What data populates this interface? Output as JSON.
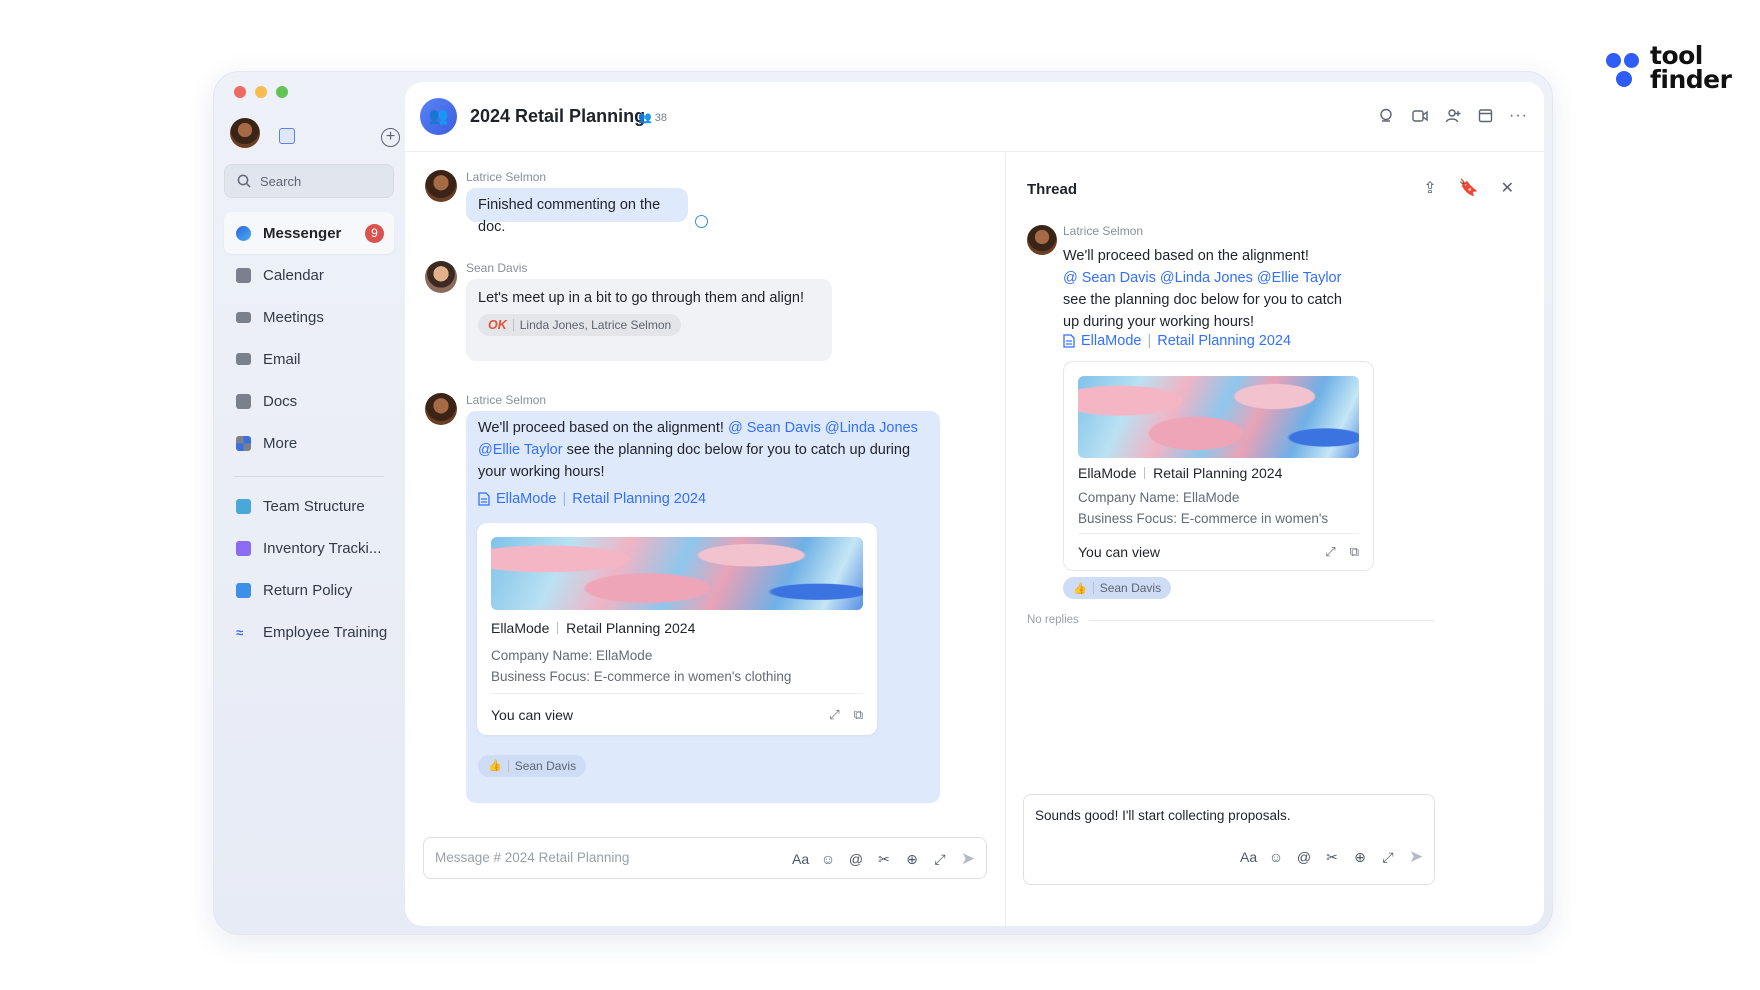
{
  "brand": {
    "name_line1": "tool",
    "name_line2": "finder"
  },
  "window": {
    "colors": {
      "close": "#ee6a5f",
      "minimize": "#f5bd4f",
      "maximize": "#61c454"
    }
  },
  "sidebar": {
    "search_placeholder": "Search",
    "nav": [
      {
        "label": "Messenger",
        "icon": "messenger-icon",
        "badge": "9",
        "active": true
      },
      {
        "label": "Calendar",
        "icon": "calendar-icon"
      },
      {
        "label": "Meetings",
        "icon": "video-icon"
      },
      {
        "label": "Email",
        "icon": "email-icon"
      },
      {
        "label": "Docs",
        "icon": "docs-icon"
      },
      {
        "label": "More",
        "icon": "grid-icon"
      }
    ],
    "pinned": [
      {
        "label": "Team Structure",
        "color": "#4aa8d8"
      },
      {
        "label": "Inventory Tracki...",
        "color": "#8b6cf0"
      },
      {
        "label": "Return Policy",
        "color": "#3f8ee8"
      },
      {
        "label": "Employee Training",
        "color": "#3a6fe0"
      }
    ]
  },
  "header": {
    "title": "2024 Retail Planning",
    "member_count": "38"
  },
  "messages": [
    {
      "author": "Latrice Selmon",
      "text": "Finished commenting on the doc."
    },
    {
      "author": "Sean Davis",
      "text": "Let's meet up in a bit to go through them and align!",
      "reaction": {
        "emoji": "OK",
        "users": "Linda Jones, Latrice Selmon"
      }
    },
    {
      "author": "Latrice Selmon",
      "text_before": "We'll proceed based on the alignment! ",
      "mentions": [
        "@ Sean Davis",
        "@Linda Jones",
        "@Ellie Taylor"
      ],
      "text_after": " see the planning doc below for you to catch up during your working hours!",
      "doc_link": {
        "owner": "EllaMode",
        "sep": "|",
        "title": "Retail Planning 2024"
      },
      "card": {
        "title_owner": "EllaMode",
        "title_name": "Retail Planning 2024",
        "meta_line1": "Company Name: EllaMode",
        "meta_line2": "Business Focus: E-commerce in women's clothing",
        "permission": "You can view"
      },
      "reaction": {
        "users": "Sean Davis"
      }
    }
  ],
  "composer": {
    "placeholder": "Message # 2024 Retail Planning"
  },
  "thread": {
    "title": "Thread",
    "author": "Latrice Selmon",
    "text_line1": "We'll proceed based on the alignment!",
    "mentions": "@ Sean Davis @Linda Jones @Ellie Taylor",
    "text_line2": "see the planning doc below for you to catch up during your working hours!",
    "doc_link": {
      "owner": "EllaMode",
      "sep": "|",
      "title": "Retail Planning 2024"
    },
    "card": {
      "title_owner": "EllaMode",
      "title_name": "Retail Planning 2024",
      "meta_line1": "Company Name: EllaMode",
      "meta_line2": "Business Focus: E-commerce in women's",
      "permission": "You can view"
    },
    "reaction_users": "Sean Davis",
    "no_replies": "No replies",
    "reply_text": "Sounds good! I'll start collecting proposals."
  },
  "toolbar_icons": [
    "font-format-icon",
    "emoji-icon",
    "mention-icon",
    "scissors-icon",
    "add-icon",
    "expand-icon",
    "send-icon"
  ]
}
